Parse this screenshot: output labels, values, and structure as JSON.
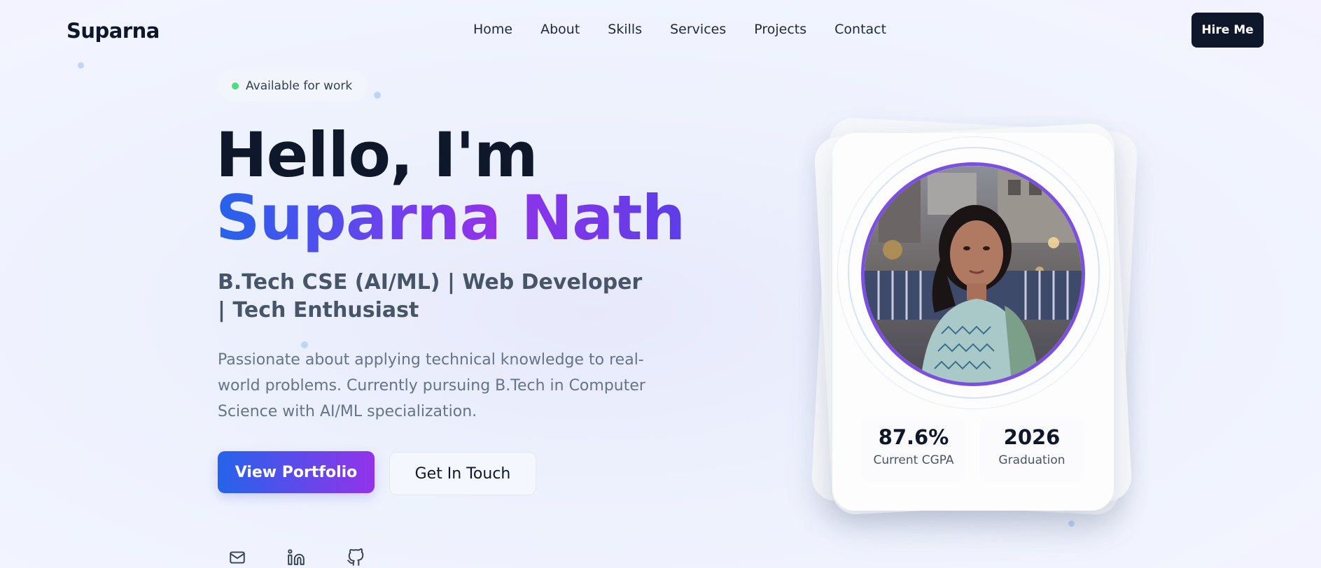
{
  "nav": {
    "logo": "Suparna",
    "items": [
      "Home",
      "About",
      "Skills",
      "Services",
      "Projects",
      "Contact"
    ],
    "cta": "Hire Me"
  },
  "hero": {
    "badge": "Available for work",
    "greeting": "Hello, I'm",
    "name": "Suparna Nath",
    "subtitle": "B.Tech CSE (AI/ML) | Web Developer | Tech Enthusiast",
    "description": "Passionate about applying technical knowledge to real-world problems. Currently pursuing B.Tech in Computer Science with AI/ML specialization.",
    "primary_button": "View Portfolio",
    "secondary_button": "Get In Touch",
    "social_icons": [
      "mail-icon",
      "linkedin-icon",
      "github-icon"
    ]
  },
  "profile_card": {
    "stats": [
      {
        "value": "87.6%",
        "label": "Current CGPA"
      },
      {
        "value": "2026",
        "label": "Graduation"
      }
    ]
  },
  "colors": {
    "primary_dark": "#0f172a",
    "gradient_start": "#2563eb",
    "gradient_end": "#9333ea",
    "status_green": "#4ade80"
  }
}
